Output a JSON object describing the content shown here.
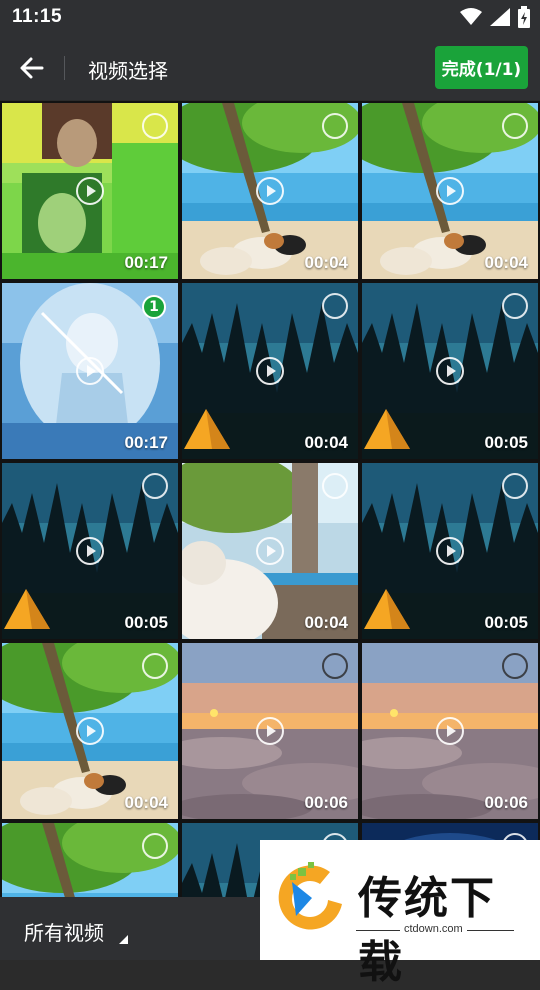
{
  "status_bar": {
    "time": "11:15"
  },
  "app_bar": {
    "title": "视频选择",
    "done_label": "完成(1/1)"
  },
  "grid": {
    "items": [
      {
        "scene": "glitch-girl",
        "duration": "00:17",
        "selected": false
      },
      {
        "scene": "beach-cats",
        "duration": "00:04",
        "selected": false
      },
      {
        "scene": "beach-cats",
        "duration": "00:04",
        "selected": false
      },
      {
        "scene": "anime-girl",
        "duration": "00:17",
        "selected": true,
        "order": "1"
      },
      {
        "scene": "night-tent",
        "duration": "00:04",
        "selected": false
      },
      {
        "scene": "night-tent",
        "duration": "00:05",
        "selected": false
      },
      {
        "scene": "night-tent",
        "duration": "00:05",
        "selected": false
      },
      {
        "scene": "dog-pier",
        "duration": "00:04",
        "selected": false
      },
      {
        "scene": "night-tent",
        "duration": "00:05",
        "selected": false
      },
      {
        "scene": "beach-cats",
        "duration": "00:04",
        "selected": false
      },
      {
        "scene": "sunset-clouds",
        "duration": "00:06",
        "selected": false
      },
      {
        "scene": "sunset-clouds",
        "duration": "00:06",
        "selected": false
      },
      {
        "scene": "beach-cats",
        "duration": "",
        "selected": false
      },
      {
        "scene": "night-tent",
        "duration": "",
        "selected": false
      },
      {
        "scene": "night-sky",
        "duration": "",
        "selected": false
      }
    ]
  },
  "bottom_bar": {
    "album_label": "所有视频"
  },
  "watermark": {
    "brand": "传统下载",
    "domain": "ctdown.com"
  },
  "colors": {
    "accent": "#1aa33a",
    "bar": "#2f3033"
  }
}
